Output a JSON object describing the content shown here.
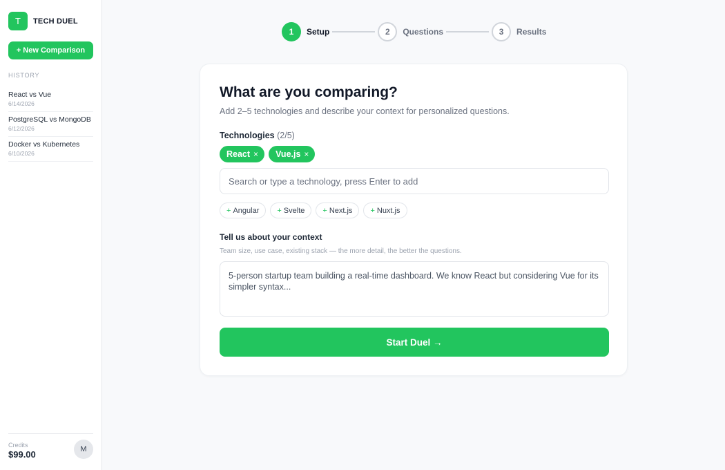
{
  "app": {
    "logo_letter": "T",
    "name": "TECH DUEL",
    "accent": "#22c55e"
  },
  "sidebar": {
    "new_button": "+ New Comparison",
    "history_heading": "HISTORY",
    "history": [
      {
        "title": "React vs Vue",
        "date": "6/14/2026"
      },
      {
        "title": "PostgreSQL vs MongoDB",
        "date": "6/12/2026"
      },
      {
        "title": "Docker vs Kubernetes",
        "date": "6/10/2026"
      }
    ],
    "credits_label": "Credits",
    "credits_value": "$99.00",
    "avatar_letter": "M"
  },
  "stepper": {
    "steps": [
      {
        "number": "1",
        "label": "Setup",
        "state": "active"
      },
      {
        "number": "2",
        "label": "Questions",
        "state": "idle"
      },
      {
        "number": "3",
        "label": "Results",
        "state": "idle"
      }
    ]
  },
  "form": {
    "title": "What are you comparing?",
    "subtitle": "Add 2–5 technologies and describe your context for personalized questions.",
    "tech_label": "Technologies",
    "tech_count": "(2/5)",
    "selected": [
      {
        "name": "React",
        "remove_icon": "close-icon",
        "remove_glyph": "×"
      },
      {
        "name": "Vue.js",
        "remove_icon": "close-icon",
        "remove_glyph": "×"
      }
    ],
    "search_placeholder": "Search or type a technology, press Enter to add",
    "search_value": "",
    "suggestion_prefix": "+",
    "suggestions": [
      "Angular",
      "Svelte",
      "Next.js",
      "Nuxt.js"
    ],
    "context_label": "Tell us about your context",
    "context_help": "Team size, use case, existing stack — the more detail, the better the questions.",
    "context_placeholder": "5-person startup team building a real-time dashboard. We know React but considering Vue for its simpler syntax...",
    "context_value": "",
    "start_button": "Start Duel →"
  }
}
